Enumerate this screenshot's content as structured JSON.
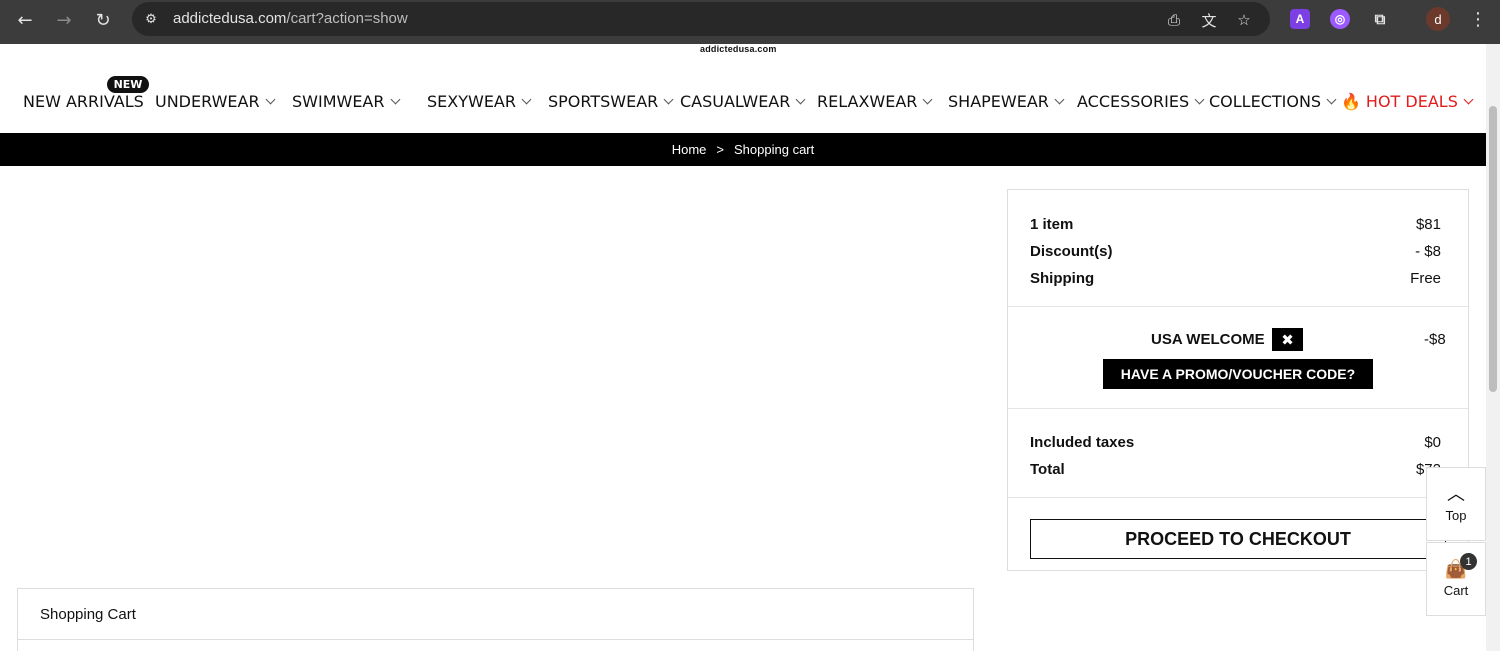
{
  "browser": {
    "url_host": "addictedusa.com",
    "url_path": "/cart?action=show",
    "profile_initial": "d",
    "extension_a_label": "A"
  },
  "site": {
    "logo_text": "addictedusa.com"
  },
  "menu": {
    "new_badge": "NEW",
    "items": [
      {
        "label": "NEW ARRIVALS"
      },
      {
        "label": "UNDERWEAR"
      },
      {
        "label": "SWIMWEAR"
      },
      {
        "label": "SEXYWEAR"
      },
      {
        "label": "SPORTSWEAR"
      },
      {
        "label": "CASUALWEAR"
      },
      {
        "label": "RELAXWEAR"
      },
      {
        "label": "SHAPEWEAR"
      },
      {
        "label": "ACCESSORIES"
      },
      {
        "label": "COLLECTIONS"
      },
      {
        "label": "HOT DEALS"
      }
    ],
    "hot_color": "#e21c1c"
  },
  "breadcrumb": {
    "home": "Home",
    "separator": ">",
    "current": "Shopping cart"
  },
  "summary": {
    "items_label": "1 item",
    "items_value": "$81",
    "discount_label": "Discount(s)",
    "discount_value": "- $8",
    "shipping_label": "Shipping",
    "shipping_value": "Free",
    "promo_name": "USA WELCOME",
    "promo_amount": "-$8",
    "promo_button": "HAVE A PROMO/VOUCHER CODE?",
    "taxes_label": "Included taxes",
    "taxes_value": "$0",
    "total_label": "Total",
    "total_value": "$72",
    "checkout_button": "PROCEED TO CHECKOUT"
  },
  "floating": {
    "top_label": "Top",
    "cart_label": "Cart",
    "cart_count": "1"
  },
  "cart_panel": {
    "title": "Shopping Cart"
  }
}
